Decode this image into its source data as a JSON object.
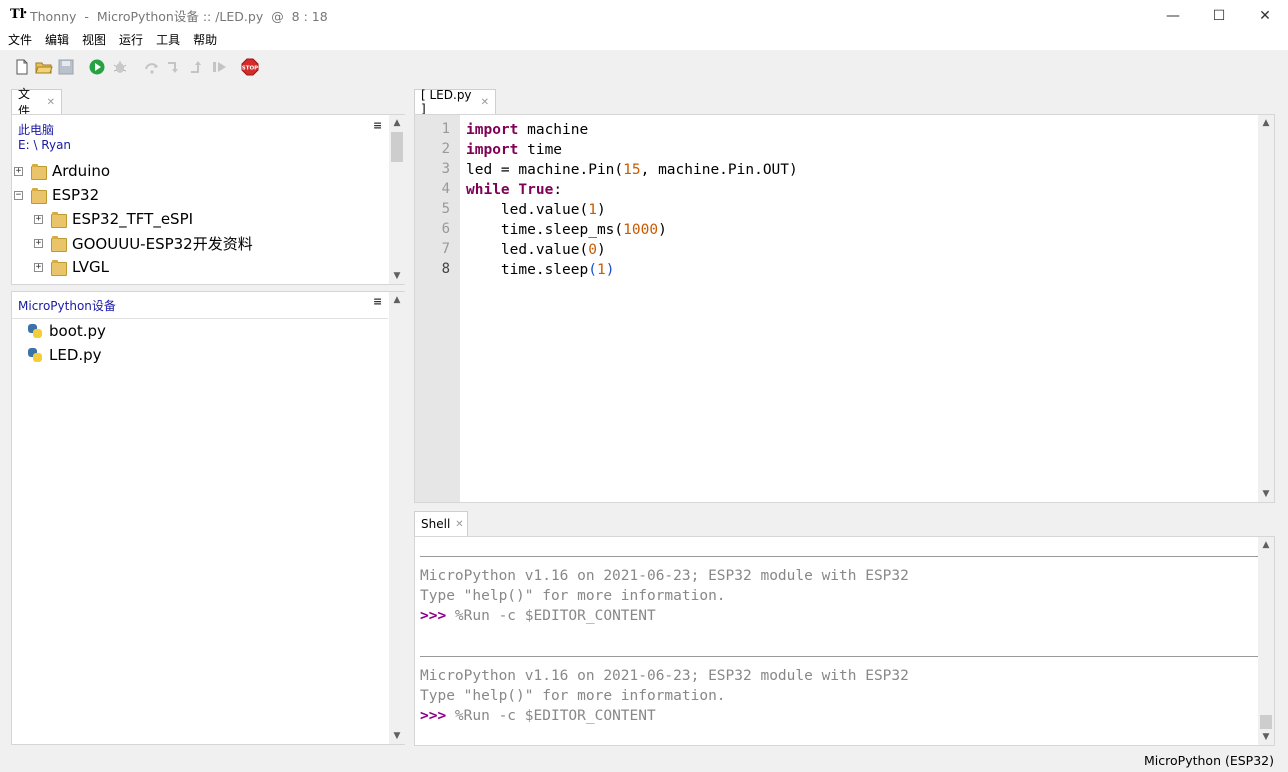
{
  "window": {
    "app_name": "Thonny",
    "title_sep1": "-",
    "title_path": "MicroPython设备 :: /LED.py",
    "title_sep2": "@",
    "title_position": "8 : 18",
    "minimize": "—",
    "maximize": "☐",
    "close": "✕"
  },
  "menu": {
    "items": [
      "文件",
      "编辑",
      "视图",
      "运行",
      "工具",
      "帮助"
    ]
  },
  "toolbar": {
    "icons": [
      "new-file-icon",
      "open-file-icon",
      "save-file-icon",
      "run-icon",
      "debug-icon",
      "step-over-icon",
      "step-into-icon",
      "step-out-icon",
      "resume-icon",
      "stop-icon"
    ],
    "stop_label": "STOP"
  },
  "files": {
    "tab_label": "文件",
    "computer_header": "此电脑",
    "computer_path": "E: \\ Ryan",
    "menu_glyph": "≡",
    "tree": [
      {
        "label": "Arduino",
        "expander": "+",
        "depth": 0
      },
      {
        "label": "ESP32",
        "expander": "−",
        "depth": 0
      },
      {
        "label": "ESP32_TFT_eSPI",
        "expander": "+",
        "depth": 1
      },
      {
        "label": "GOOUUU-ESP32开发资料",
        "expander": "+",
        "depth": 1
      },
      {
        "label": "LVGL",
        "expander": "+",
        "depth": 1
      }
    ],
    "device_header": "MicroPython设备",
    "device_files": [
      "boot.py",
      "LED.py"
    ]
  },
  "editor": {
    "tab_label": "[ LED.py ]",
    "line_numbers": [
      "1",
      "2",
      "3",
      "4",
      "5",
      "6",
      "7",
      "8"
    ],
    "current_line": 8,
    "code": [
      [
        {
          "t": "import",
          "c": "kw"
        },
        {
          "t": " machine",
          "c": ""
        }
      ],
      [
        {
          "t": "import",
          "c": "kw"
        },
        {
          "t": " time",
          "c": ""
        }
      ],
      [
        {
          "t": "led = machine.Pin(",
          "c": ""
        },
        {
          "t": "15",
          "c": "num"
        },
        {
          "t": ", machine.Pin.OUT)",
          "c": ""
        }
      ],
      [
        {
          "t": "while",
          "c": "kw"
        },
        {
          "t": " ",
          "c": ""
        },
        {
          "t": "True",
          "c": "kw2"
        },
        {
          "t": ":",
          "c": ""
        }
      ],
      [
        {
          "t": "    led.value(",
          "c": ""
        },
        {
          "t": "1",
          "c": "num"
        },
        {
          "t": ")",
          "c": ""
        }
      ],
      [
        {
          "t": "    time.sleep_ms(",
          "c": ""
        },
        {
          "t": "1000",
          "c": "num"
        },
        {
          "t": ")",
          "c": ""
        }
      ],
      [
        {
          "t": "    led.value(",
          "c": ""
        },
        {
          "t": "0",
          "c": "num"
        },
        {
          "t": ")",
          "c": ""
        }
      ],
      [
        {
          "t": "    time.sleep",
          "c": ""
        },
        {
          "t": "(",
          "c": "numb"
        },
        {
          "t": "1",
          "c": "num"
        },
        {
          "t": ")",
          "c": "numb"
        }
      ]
    ]
  },
  "shell": {
    "tab_label": "Shell",
    "banner1": "MicroPython v1.16 on 2021-06-23; ESP32 module with ESP32",
    "help1": "Type \"help()\" for more information.",
    "prompt1": ">>>",
    "cmd1": " %Run -c $EDITOR_CONTENT",
    "banner2": "MicroPython v1.16 on 2021-06-23; ESP32 module with ESP32",
    "help2": "Type \"help()\" for more information.",
    "prompt2": ">>>",
    "cmd2": " %Run -c $EDITOR_CONTENT"
  },
  "status": {
    "interpreter": "MicroPython (ESP32)"
  },
  "colors": {
    "keyword": "#7f0055",
    "number": "#c85a00",
    "prompt": "#8b008b",
    "panel_header": "#1a1aa6"
  }
}
